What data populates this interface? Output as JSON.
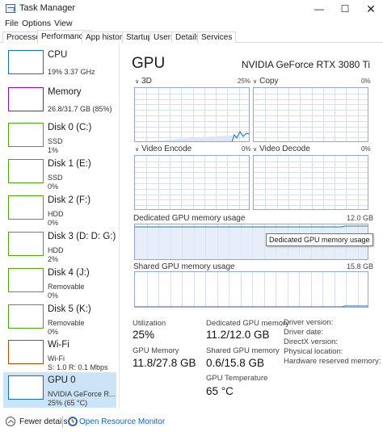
{
  "window": {
    "title": "Task Manager",
    "minimize": "—",
    "maximize": "☐",
    "close": "✕"
  },
  "menu": [
    "File",
    "Options",
    "View"
  ],
  "tabs": [
    "Processes",
    "Performance",
    "App history",
    "Startup",
    "Users",
    "Details",
    "Services"
  ],
  "sidebar": {
    "items": [
      {
        "name": "CPU",
        "lines": [
          "19%  3.37 GHz"
        ],
        "color": "#1172b9"
      },
      {
        "name": "Memory",
        "lines": [
          "26.8/31.7 GB (85%)"
        ],
        "color": "#8b12ae"
      },
      {
        "name": "Disk 0 (C:)",
        "lines": [
          "SSD",
          "1%"
        ],
        "color": "#4da60c"
      },
      {
        "name": "Disk 1 (E:)",
        "lines": [
          "SSD",
          "0%"
        ],
        "color": "#4da60c"
      },
      {
        "name": "Disk 2 (F:)",
        "lines": [
          "HDD",
          "0%"
        ],
        "color": "#4da60c"
      },
      {
        "name": "Disk 3 (D: D: G:)",
        "lines": [
          "HDD",
          "2%"
        ],
        "color": "#4da60c"
      },
      {
        "name": "Disk 4 (J:)",
        "lines": [
          "Removable",
          "0%"
        ],
        "color": "#4da60c"
      },
      {
        "name": "Disk 5 (K:)",
        "lines": [
          "Removable",
          "0%"
        ],
        "color": "#4da60c"
      },
      {
        "name": "Wi-Fi",
        "lines": [
          "Wi-Fi",
          "S: 1.0  R: 0.1 Mbps"
        ],
        "color": "#a74f01"
      },
      {
        "name": "GPU 0",
        "lines": [
          "NVIDIA GeForce R...",
          "25% (65 °C)"
        ],
        "color": "#1172b9"
      }
    ]
  },
  "main": {
    "title": "GPU",
    "model": "NVIDIA GeForce RTX 3080 Ti",
    "graphs": [
      {
        "label": "3D",
        "pct": "25%"
      },
      {
        "label": "Copy",
        "pct": "0%"
      },
      {
        "label": "Video Encode",
        "pct": "0%"
      },
      {
        "label": "Video Decode",
        "pct": "0%"
      }
    ],
    "dedicated": {
      "label": "Dedicated GPU memory usage",
      "max": "12.0 GB",
      "fill": 0.93
    },
    "shared": {
      "label": "Shared GPU memory usage",
      "max": "15.8 GB",
      "fill": 0.04
    },
    "tooltip": "Dedicated GPU memory usage",
    "stats": {
      "utilization_label": "Utilization",
      "utilization": "25%",
      "dedicated_label": "Dedicated GPU memory",
      "dedicated": "11.2/12.0 GB",
      "gpumem_label": "GPU Memory",
      "gpumem": "11.8/27.8 GB",
      "shared_label": "Shared GPU memory",
      "shared": "0.6/15.8 GB",
      "temp_label": "GPU Temperature",
      "temp": "65 °C"
    },
    "info": [
      "Driver version:",
      "Driver date:",
      "DirectX version:",
      "Physical location:",
      "Hardware reserved memory:"
    ]
  },
  "footer": {
    "fewer": "Fewer details",
    "resource_monitor": "Open Resource Monitor"
  },
  "colors": {
    "accent": "#1172b9",
    "graph_border": "#94a5d1",
    "grid": "#d6def0",
    "selected": "#cce4f7"
  }
}
